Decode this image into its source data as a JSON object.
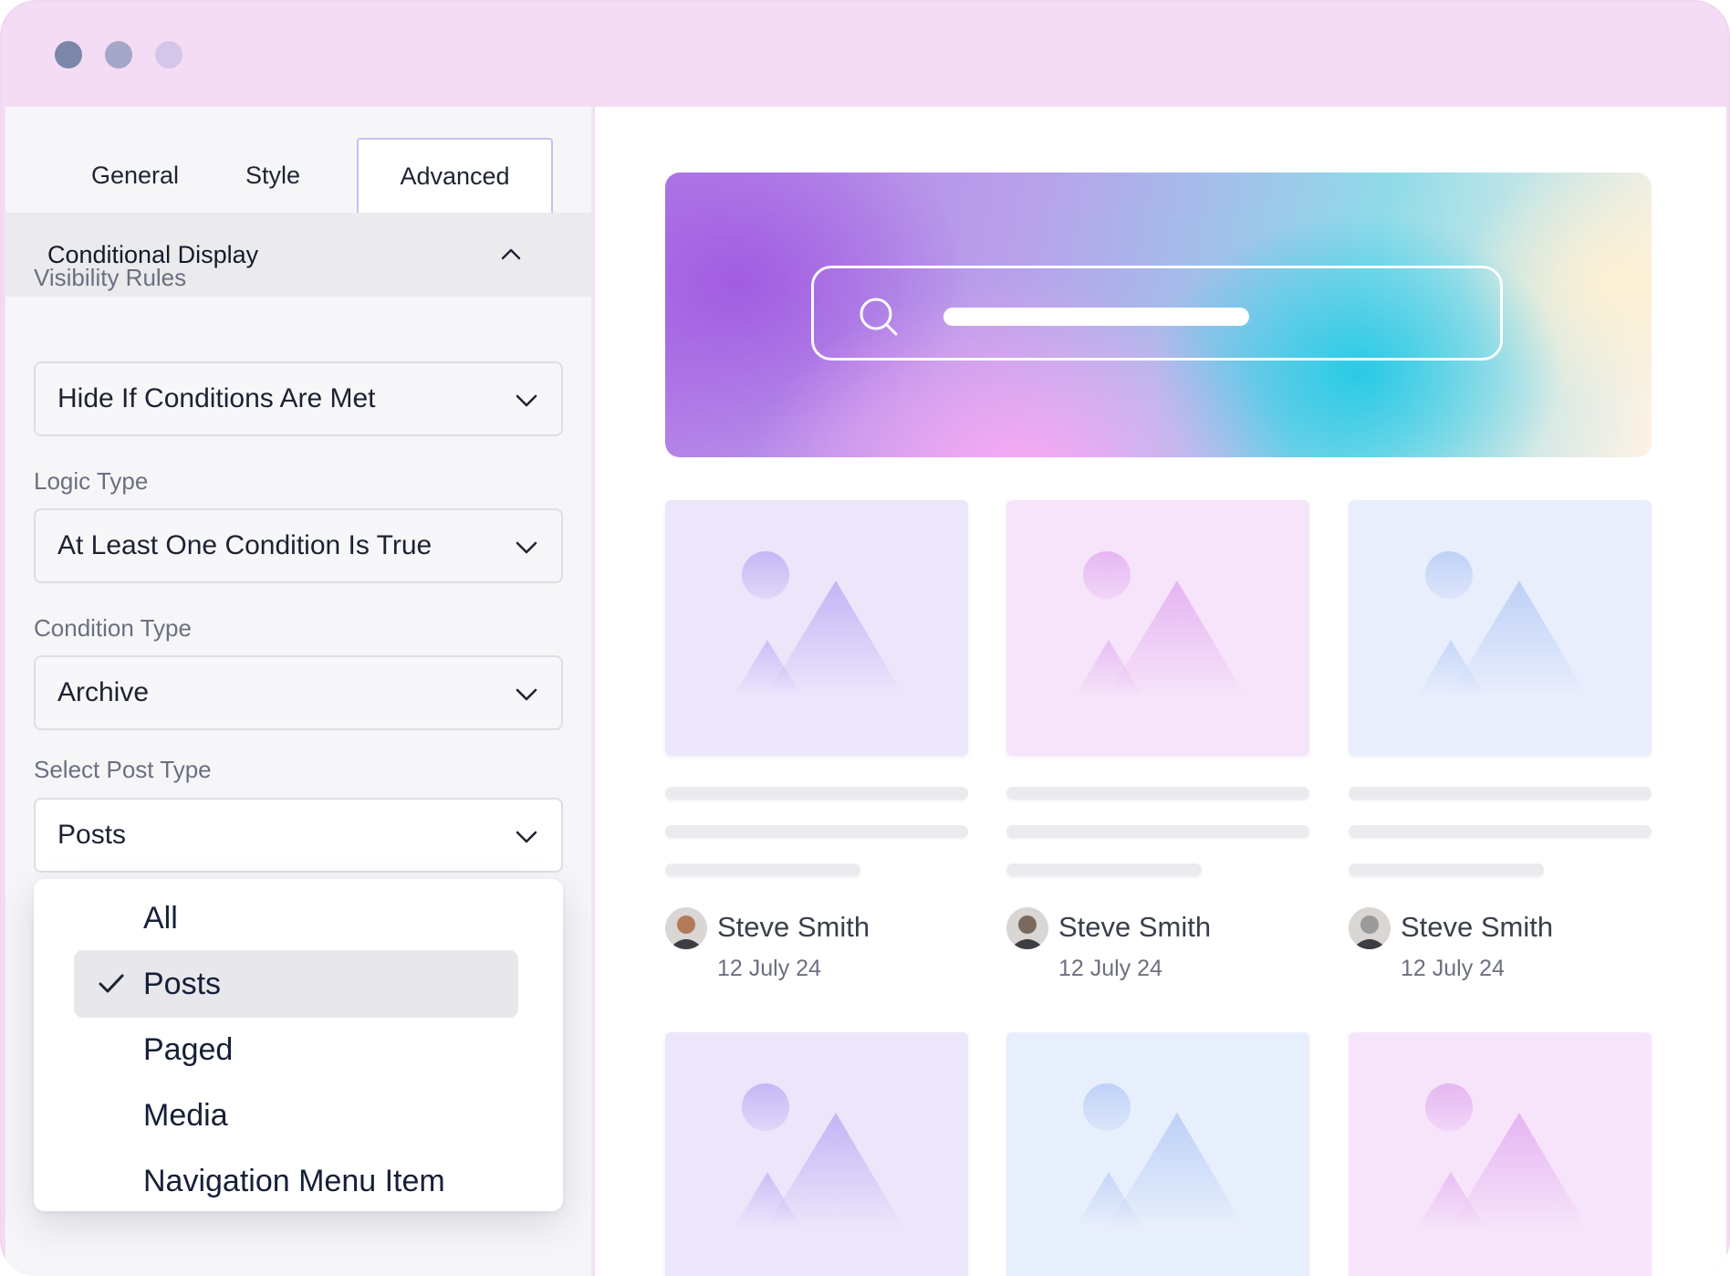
{
  "window": {
    "controls": [
      "close",
      "minimize",
      "maximize"
    ]
  },
  "panel": {
    "tabs": [
      {
        "label": "General",
        "active": false
      },
      {
        "label": "Style",
        "active": false
      },
      {
        "label": "Advanced",
        "active": true
      }
    ],
    "section": {
      "title": "Conditional Display",
      "expanded": true,
      "icon": "chevron-up-icon"
    },
    "fields": {
      "visibility_rules": {
        "label": "Visibility Rules",
        "value": "Hide If Conditions Are Met"
      },
      "logic_type": {
        "label": "Logic Type",
        "value": "At Least One Condition Is True"
      },
      "condition_type": {
        "label": "Condition Type",
        "value": "Archive"
      },
      "post_type": {
        "label": "Select Post Type",
        "value": "Posts"
      }
    },
    "dropdown": {
      "options": [
        {
          "label": "All",
          "selected": false
        },
        {
          "label": "Posts",
          "selected": true
        },
        {
          "label": "Paged",
          "selected": false
        },
        {
          "label": "Media",
          "selected": false
        },
        {
          "label": "Navigation Menu Item",
          "selected": false
        }
      ]
    }
  },
  "preview": {
    "hero": {
      "icon": "search-icon"
    },
    "cards": [
      {
        "author": "Steve Smith",
        "date": "12 July 24",
        "tint": "#ece6fb",
        "accent": "#c4b4f5"
      },
      {
        "author": "Steve Smith",
        "date": "12 July 24",
        "tint": "#f6e4fa",
        "accent": "#e5b4f2"
      },
      {
        "author": "Steve Smith",
        "date": "12 July 24",
        "tint": "#e9eefc",
        "accent": "#bdd0f7"
      },
      {
        "tint": "#ece6fb",
        "accent": "#c4b4f5"
      },
      {
        "tint": "#e8effc",
        "accent": "#bdd0f7"
      },
      {
        "tint": "#f6e4fa",
        "accent": "#e5b4f2"
      }
    ]
  },
  "colors": {
    "window_chrome": "#f3dcf4",
    "panel_bg": "#f6f6f8",
    "active_tab_border": "#c7c0ec",
    "selected_option_bg": "#e8e8ec"
  }
}
